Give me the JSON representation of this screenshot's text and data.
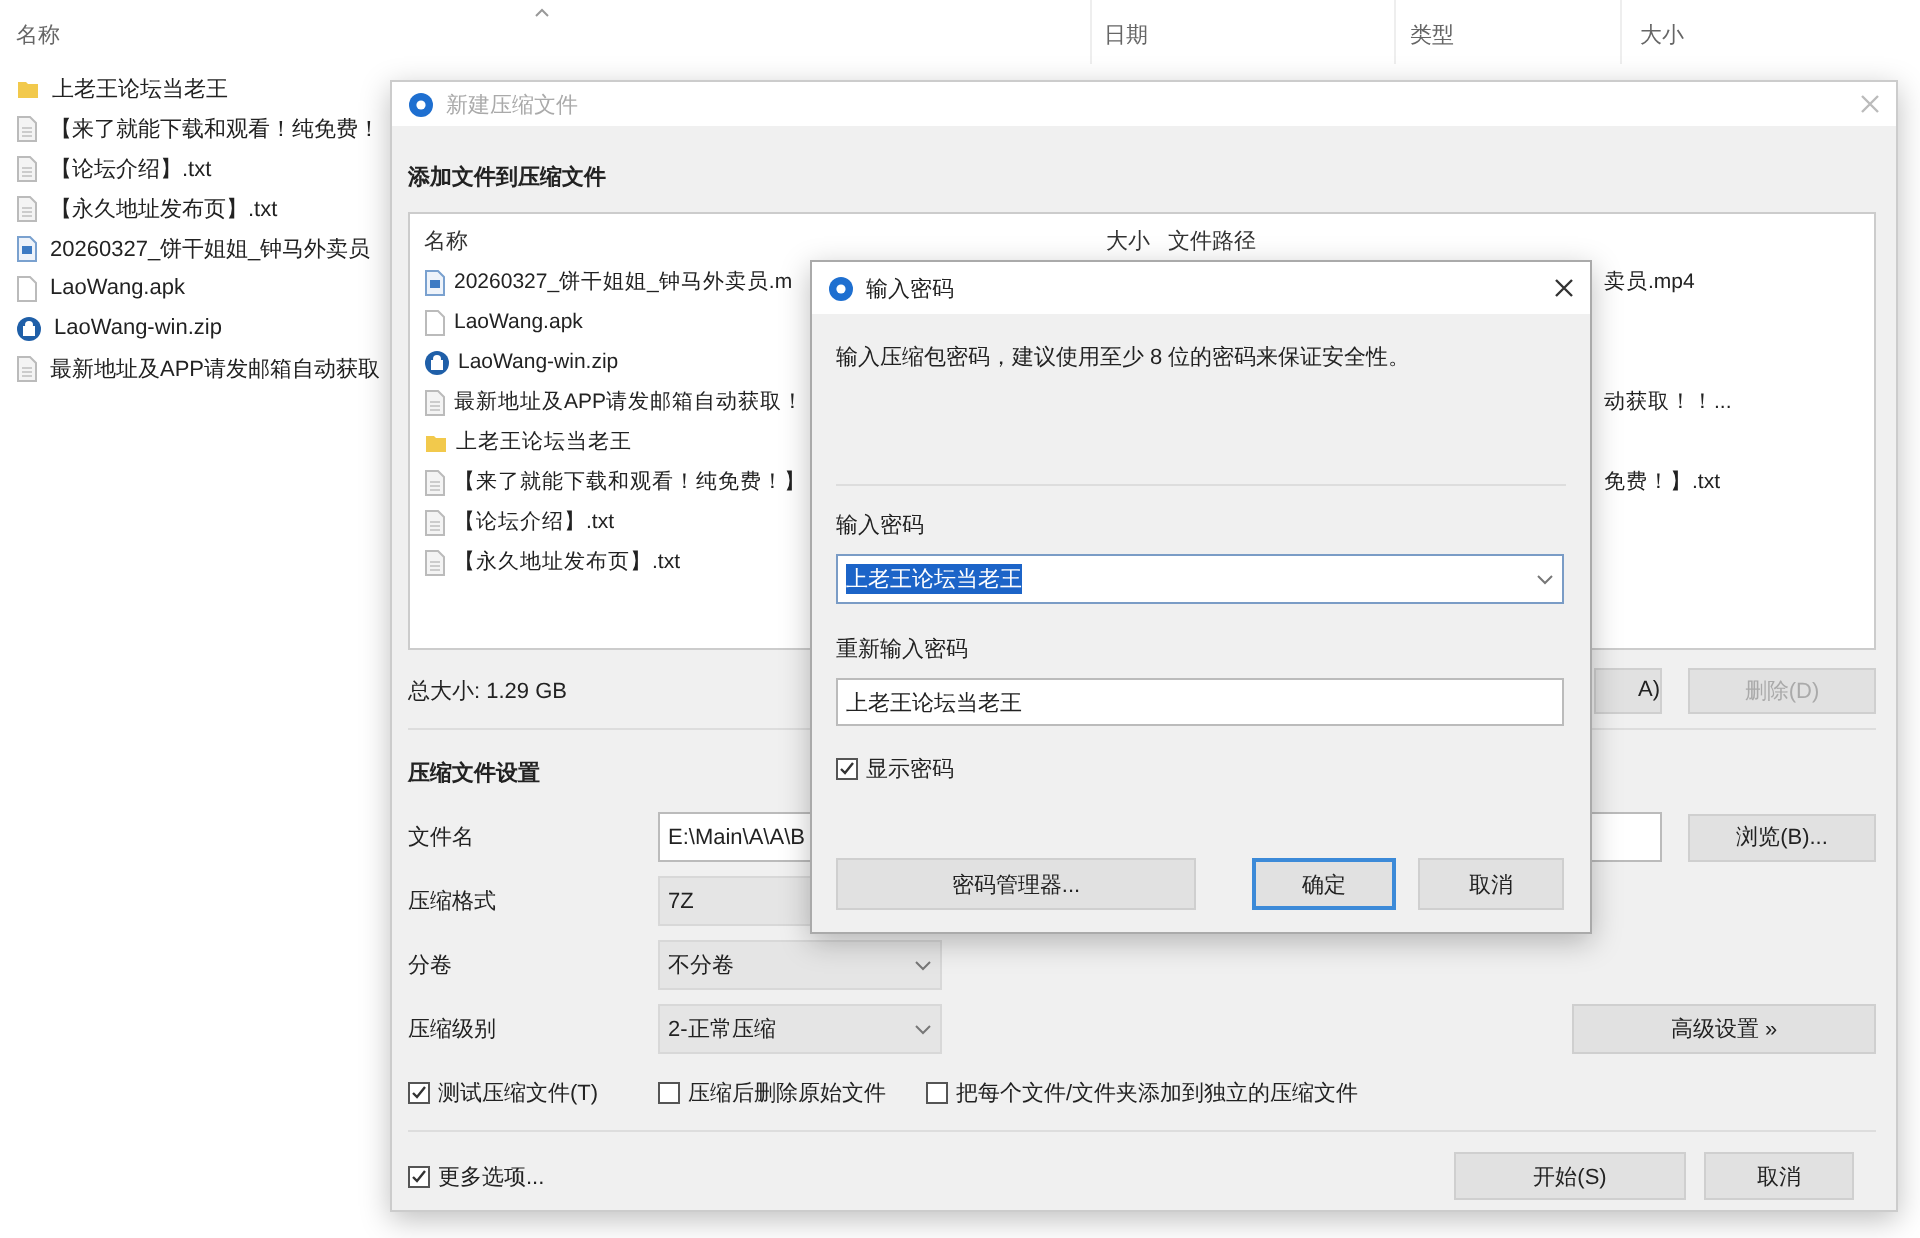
{
  "explorer": {
    "columns": [
      "名称",
      "日期",
      "类型",
      "大小"
    ],
    "items": [
      {
        "name": "上老王论坛当老王",
        "kind": "folder"
      },
      {
        "name": "【来了就能下载和观看！纯免费！",
        "kind": "text"
      },
      {
        "name": "【论坛介绍】.txt",
        "kind": "text"
      },
      {
        "name": "【永久地址发布页】.txt",
        "kind": "text"
      },
      {
        "name": "20260327_饼干姐姐_钟马外卖员",
        "kind": "video"
      },
      {
        "name": "LaoWang.apk",
        "kind": "blank"
      },
      {
        "name": "LaoWang-win.zip",
        "kind": "zip"
      },
      {
        "name": "最新地址及APP请发邮箱自动获取",
        "kind": "text"
      }
    ]
  },
  "compress_dialog": {
    "title": "新建压缩文件",
    "section_title": "添加文件到压缩文件",
    "file_list": {
      "columns": [
        "名称",
        "大小",
        "文件路径"
      ],
      "rows": [
        {
          "name": "20260327_饼干姐姐_钟马外卖员.m",
          "kind": "video",
          "path": "卖员.mp4"
        },
        {
          "name": "LaoWang.apk",
          "kind": "blank"
        },
        {
          "name": "LaoWang-win.zip",
          "kind": "zip"
        },
        {
          "name": "最新地址及APP请发邮箱自动获取！",
          "kind": "text",
          "path": "动获取！！..."
        },
        {
          "name": "上老王论坛当老王",
          "kind": "folder"
        },
        {
          "name": "【来了就能下载和观看！纯免费！】",
          "kind": "text",
          "path": "免费！】.txt"
        },
        {
          "name": "【论坛介绍】.txt",
          "kind": "text"
        },
        {
          "name": "【永久地址发布页】.txt",
          "kind": "text"
        }
      ]
    },
    "total_size": "总大小: 1.29 GB",
    "add_button": "A)",
    "delete_button": {
      "label": "删除(D)",
      "disabled": true
    },
    "settings_title": "压缩文件设置",
    "filename": {
      "label": "文件名",
      "value": "E:\\Main\\A\\A\\B"
    },
    "browse_button": "浏览(B)...",
    "format": {
      "label": "压缩格式",
      "value": "7Z"
    },
    "split": {
      "label": "分卷",
      "value": "不分卷"
    },
    "level": {
      "label": "压缩级别",
      "value": "2-正常压缩"
    },
    "advanced_button": "高级设置 »",
    "options": [
      {
        "label": "测试压缩文件(T)",
        "checked": true
      },
      {
        "label": "压缩后删除原始文件",
        "checked": false
      },
      {
        "label": "把每个文件/文件夹添加到独立的压缩文件",
        "checked": false
      }
    ],
    "more_options": {
      "label": "更多选项...",
      "checked": true
    },
    "start_button": "开始(S)",
    "cancel_button": "取消"
  },
  "password_dialog": {
    "title": "输入密码",
    "description": "输入压缩包密码，建议使用至少 8 位的密码来保证安全性。",
    "password": {
      "label": "输入密码",
      "value": "上老王论坛当老王",
      "text_selected": true
    },
    "confirm": {
      "label": "重新输入密码",
      "value": "上老王论坛当老王"
    },
    "show_password": {
      "label": "显示密码",
      "checked": true
    },
    "manager_button": "密码管理器...",
    "ok_button": "确定",
    "cancel_button": "取消"
  }
}
